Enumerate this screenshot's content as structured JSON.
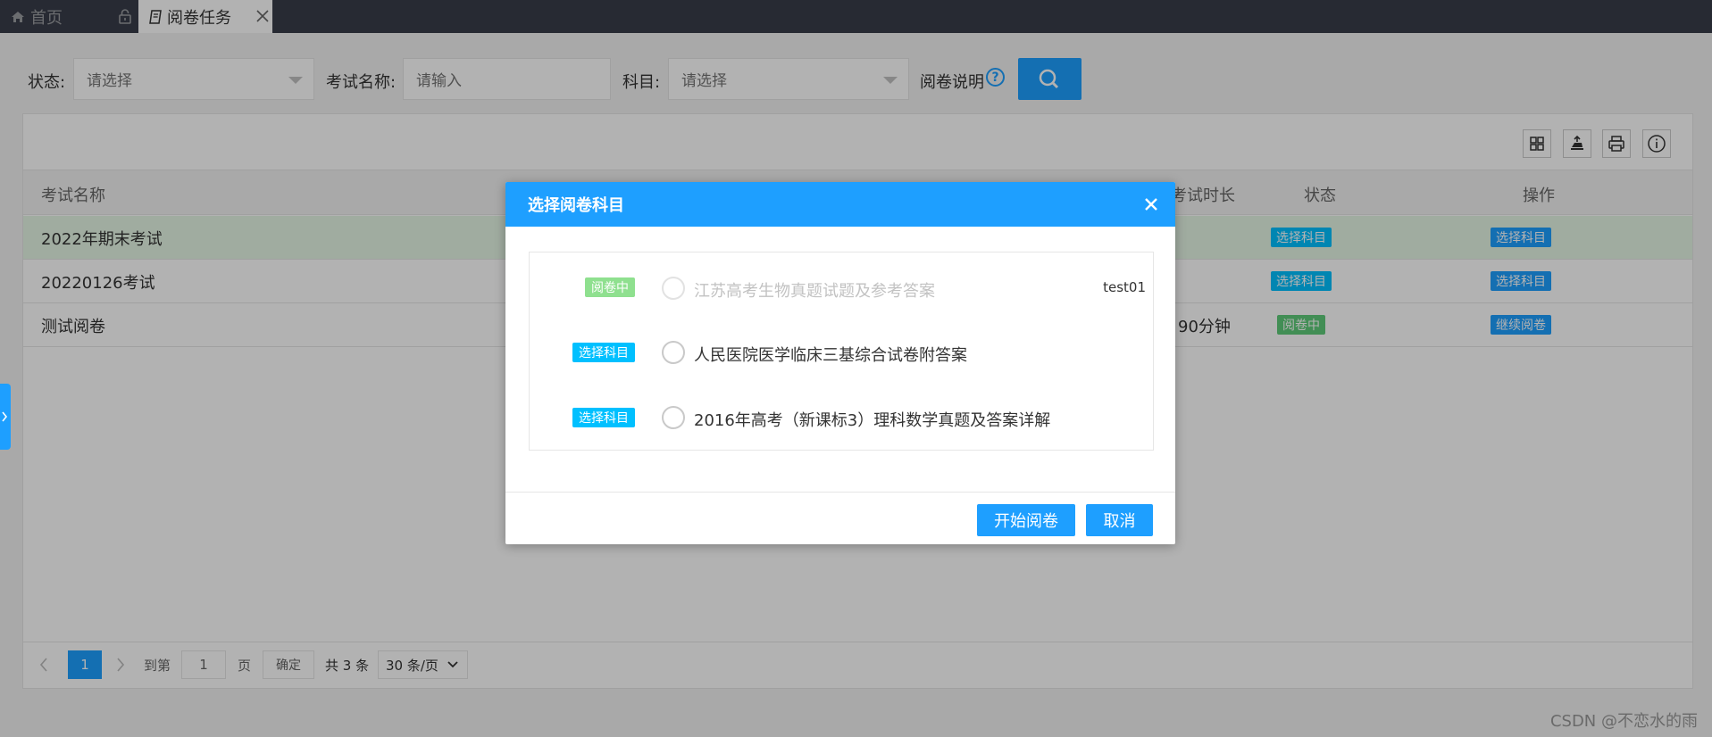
{
  "tabs": {
    "home_label": "首页",
    "task_label": "阅卷任务"
  },
  "filter": {
    "status_label": "状态:",
    "status_value": "请选择",
    "exam_name_label": "考试名称:",
    "exam_name_placeholder": "请输入",
    "subject_label": "科目:",
    "subject_value": "请选择",
    "help_label": "阅卷说明",
    "help_icon": "?"
  },
  "table": {
    "headers": {
      "name": "考试名称",
      "duration": "考试时长",
      "status": "状态",
      "action": "操作"
    },
    "rows": [
      {
        "name": "2022年期末考试",
        "duration": "",
        "status": "选择科目",
        "action": "选择科目"
      },
      {
        "name": "20220126考试",
        "duration": "",
        "status": "选择科目",
        "action": "选择科目"
      },
      {
        "name": "测试阅卷",
        "duration": "90分钟",
        "status": "阅卷中",
        "action": "继续阅卷"
      }
    ]
  },
  "pager": {
    "current_page": "1",
    "goto_label": "到第",
    "goto_value": "1",
    "page_unit": "页",
    "confirm": "确定",
    "total": "共 3 条",
    "per_page": "30 条/页"
  },
  "dialog": {
    "title": "选择阅卷科目",
    "items": [
      {
        "badge": "阅卷中",
        "text": "江苏高考生物真题试题及参考答案",
        "note": "test01"
      },
      {
        "badge": "选择科目",
        "text": "人民医院医学临床三基综合试卷附答案",
        "note": ""
      },
      {
        "badge": "选择科目",
        "text": "2016年高考（新课标3）理科数学真题及答案详解",
        "note": ""
      }
    ],
    "start_button": "开始阅卷",
    "cancel_button": "取消"
  },
  "watermark": "CSDN @不恋水的雨",
  "colors": {
    "accent": "#1e9fff",
    "cyan_badge": "#00c0ff",
    "green_badge": "#5fcc7a",
    "tabbar": "#393d49"
  }
}
